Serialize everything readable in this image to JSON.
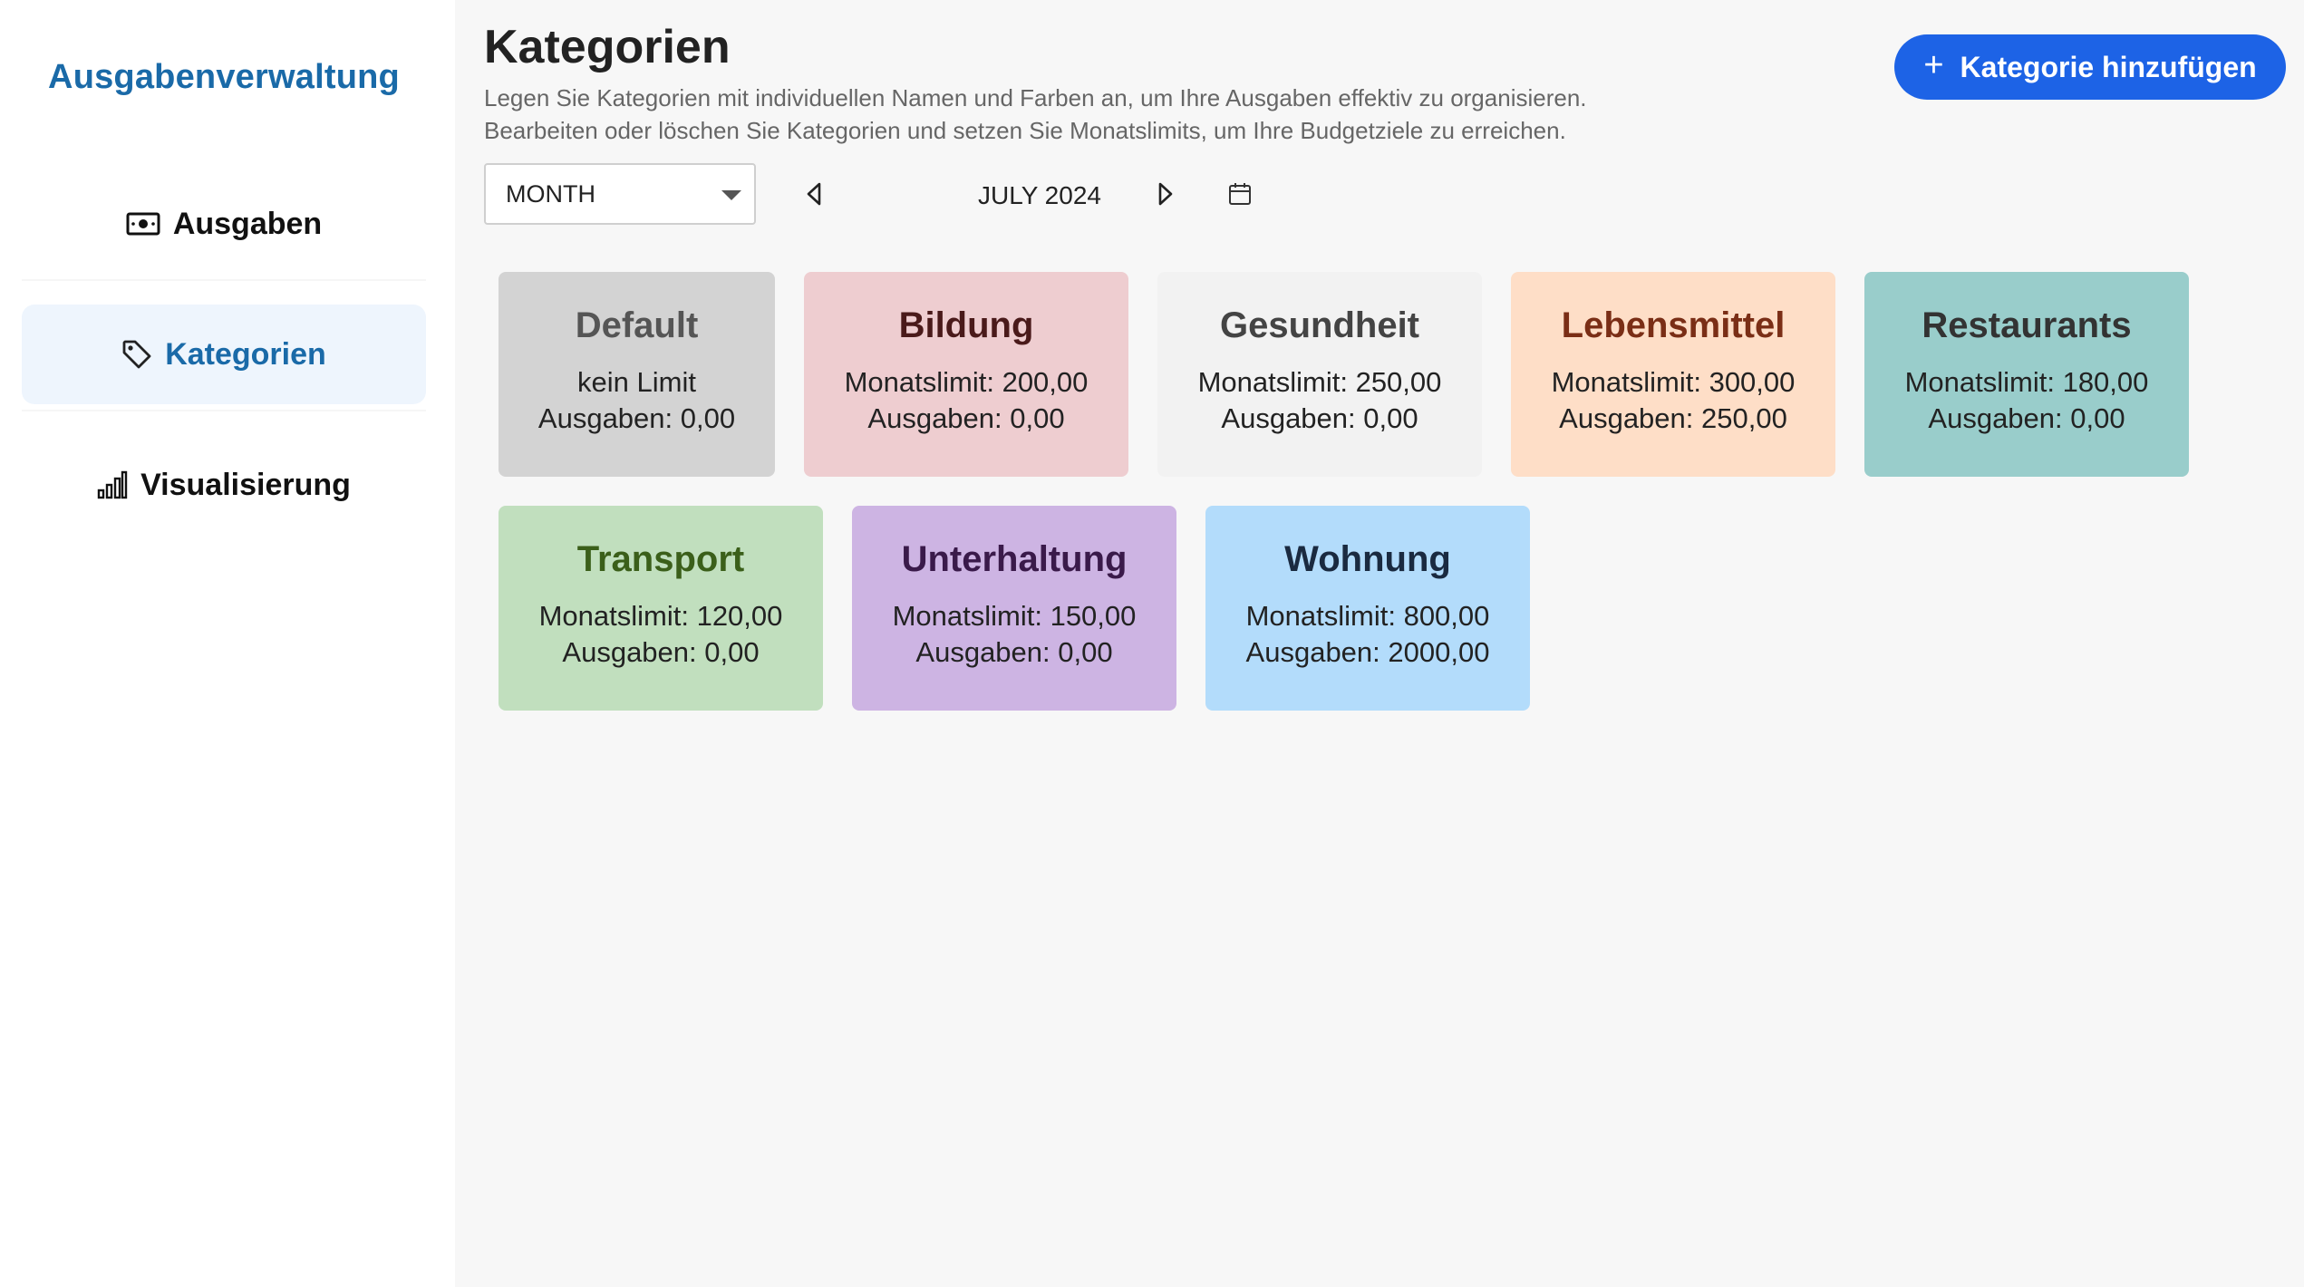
{
  "app": {
    "title": "Ausgabenverwaltung"
  },
  "sidebar": {
    "items": [
      {
        "label": "Ausgaben",
        "icon": "money-icon",
        "active": false
      },
      {
        "label": "Kategorien",
        "icon": "tag-icon",
        "active": true
      },
      {
        "label": "Visualisierung",
        "icon": "bar-chart-icon",
        "active": false
      }
    ]
  },
  "header": {
    "title": "Kategorien",
    "description_line1": "Legen Sie Kategorien mit individuellen Namen und Farben an, um Ihre Ausgaben effektiv zu organisieren.",
    "description_line2": "Bearbeiten oder löschen Sie Kategorien und setzen Sie Monatslimits, um Ihre Budgetziele zu erreichen.",
    "add_button_label": "Kategorie hinzufügen"
  },
  "period": {
    "selected": "MONTH",
    "label": "JULY 2024"
  },
  "categories": [
    {
      "name": "Default",
      "limit_text": "kein Limit",
      "spent_text": "Ausgaben: 0,00",
      "bg": "#d3d3d3",
      "color": "#555555"
    },
    {
      "name": "Bildung",
      "limit_text": "Monatslimit: 200,00",
      "spent_text": "Ausgaben: 0,00",
      "bg": "#eecdd0",
      "color": "#4a1a1a"
    },
    {
      "name": "Gesundheit",
      "limit_text": "Monatslimit: 250,00",
      "spent_text": "Ausgaben: 0,00",
      "bg": "#f2f2f2",
      "color": "#444444"
    },
    {
      "name": "Lebensmittel",
      "limit_text": "Monatslimit: 300,00",
      "spent_text": "Ausgaben: 250,00",
      "bg": "#fedec7",
      "color": "#7a2e16"
    },
    {
      "name": "Restaurants",
      "limit_text": "Monatslimit: 180,00",
      "spent_text": "Ausgaben: 0,00",
      "bg": "#99cdcb",
      "color": "#333333"
    },
    {
      "name": "Transport",
      "limit_text": "Monatslimit: 120,00",
      "spent_text": "Ausgaben: 0,00",
      "bg": "#c1dfbe",
      "color": "#3b5f1a"
    },
    {
      "name": "Unterhaltung",
      "limit_text": "Monatslimit: 150,00",
      "spent_text": "Ausgaben: 0,00",
      "bg": "#cdb4e3",
      "color": "#3a1a4a"
    },
    {
      "name": "Wohnung",
      "limit_text": "Monatslimit: 800,00",
      "spent_text": "Ausgaben: 2000,00",
      "bg": "#b3dcfb",
      "color": "#1a2a40"
    }
  ]
}
